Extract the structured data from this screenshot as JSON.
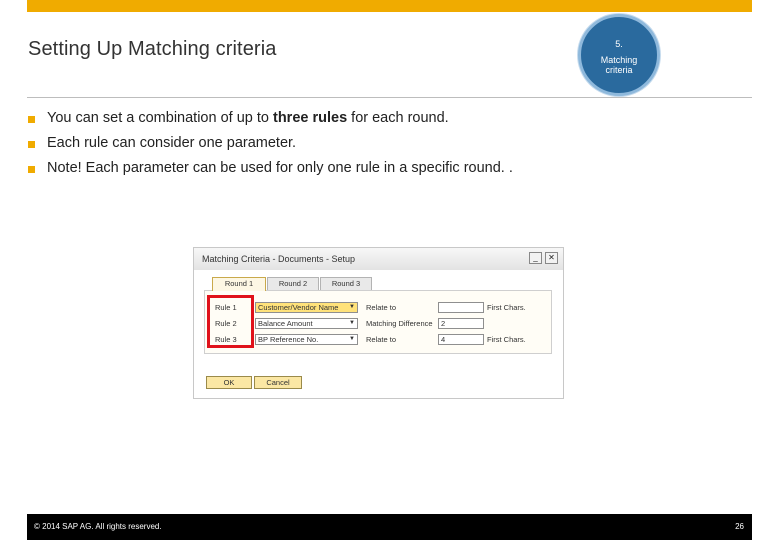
{
  "slide": {
    "title": "Setting Up Matching criteria",
    "step_number": "5.",
    "step_label": "Matching criteria",
    "bullets": [
      {
        "before": "You can set a combination of up to ",
        "bold": "three rules",
        "after": " for each round."
      },
      {
        "before": "Each rule can consider one parameter.",
        "bold": "",
        "after": ""
      },
      {
        "before": "Note! Each parameter can be used for only one rule in a specific round. .",
        "bold": "",
        "after": ""
      }
    ],
    "footer_copyright": "© 2014 SAP AG. All rights reserved.",
    "page_number": "26",
    "colors": {
      "accent": "#f0ab00",
      "step_circle": "#2a6a9e",
      "highlight_box": "#e0121b"
    }
  },
  "dialog": {
    "title": "Matching Criteria - Documents - Setup",
    "minimize_icon": "minimize-icon",
    "close_icon": "close-icon",
    "tabs": [
      {
        "label": "Round 1",
        "active": true
      },
      {
        "label": "Round 2",
        "active": false
      },
      {
        "label": "Round 3",
        "active": false
      }
    ],
    "rules": [
      {
        "rule": "Rule 1",
        "field": "Customer/Vendor Name",
        "param_label": "Relate to",
        "param_value": "",
        "unit": "First Chars."
      },
      {
        "rule": "Rule 2",
        "field": "Balance Amount",
        "param_label": "Matching Difference",
        "param_value": "2",
        "unit": ""
      },
      {
        "rule": "Rule 3",
        "field": "BP Reference No.",
        "param_label": "Relate to",
        "param_value": "4",
        "unit": "First Chars."
      }
    ],
    "ok_label": "OK",
    "cancel_label": "Cancel"
  }
}
